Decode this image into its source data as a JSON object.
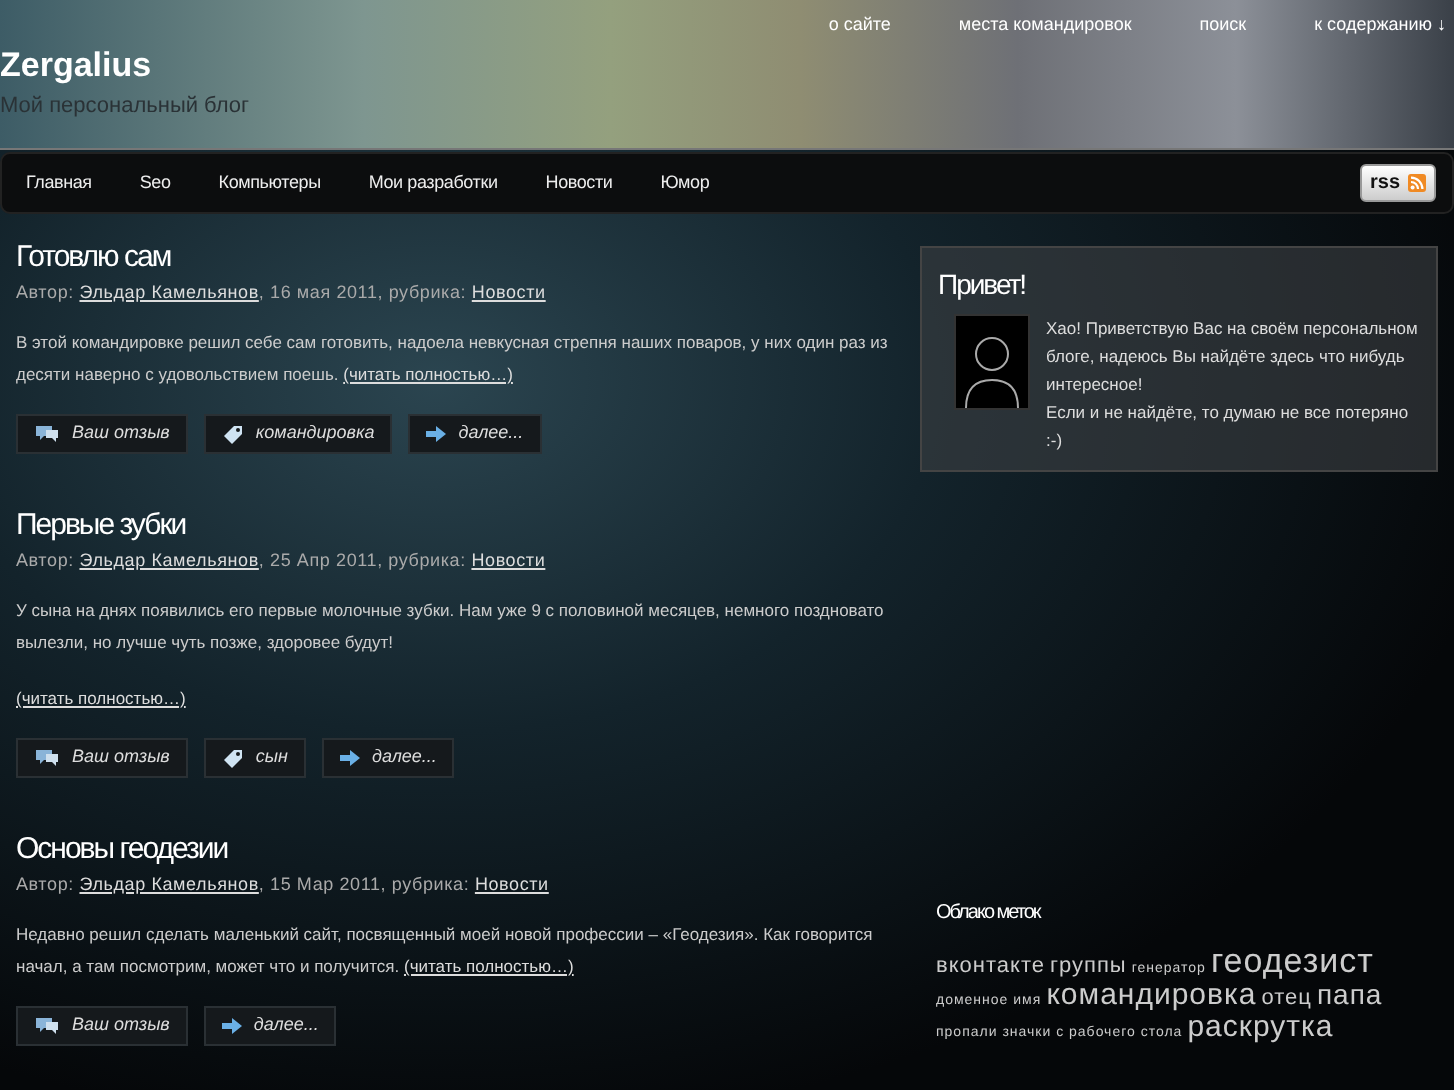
{
  "site": {
    "title": "Zergalius",
    "tagline": "Мой персональный блог"
  },
  "top_links": [
    "о сайте",
    "места командировок",
    "поиск",
    "к содержанию ↓"
  ],
  "nav": [
    "Главная",
    "Seo",
    "Компьютеры",
    "Мои разработки",
    "Новости",
    "Юмор"
  ],
  "rss": {
    "label": "rss"
  },
  "posts": [
    {
      "title": "Готовлю сам",
      "meta": {
        "prefix": "Автор:",
        "author": "Эльдар Камельянов",
        "date": ", 16 мая 2011, рубрика:",
        "category": "Новости"
      },
      "text": "В этой командировке решил себе сам готовить, надоела невкусная стрепня наших поваров, у них один раз из десяти наверно с удовольствием поешь.",
      "read_more": "(читать полностью…)",
      "read_more_separate": false,
      "buttons": [
        {
          "kind": "comment",
          "label": "Ваш отзыв"
        },
        {
          "kind": "tag",
          "label": "командировка"
        },
        {
          "kind": "more",
          "label": "далее..."
        }
      ]
    },
    {
      "title": "Первые зубки",
      "meta": {
        "prefix": "Автор:",
        "author": "Эльдар Камельянов",
        "date": ", 25 Апр 2011, рубрика:",
        "category": "Новости"
      },
      "text": "У сына на днях появились его первые молочные зубки. Нам уже 9 с половиной месяцев, немного поздновато вылезли, но лучше чуть позже, здоровее будут!",
      "read_more": "(читать полностью…)",
      "read_more_separate": true,
      "buttons": [
        {
          "kind": "comment",
          "label": "Ваш отзыв"
        },
        {
          "kind": "tag",
          "label": "сын"
        },
        {
          "kind": "more",
          "label": "далее..."
        }
      ]
    },
    {
      "title": "Основы геодезии",
      "meta": {
        "prefix": "Автор:",
        "author": "Эльдар Камельянов",
        "date": ", 15 Мар 2011, рубрика:",
        "category": "Новости"
      },
      "text": "Недавно решил сделать маленький сайт, посвященный моей новой профессии – «Геодезия». Как говорится начал, а там посмотрим, может что и получится.",
      "read_more": "(читать полностью…)",
      "read_more_separate": false,
      "buttons": [
        {
          "kind": "comment",
          "label": "Ваш отзыв"
        },
        {
          "kind": "more",
          "label": "далее..."
        }
      ]
    }
  ],
  "greeting": {
    "title": "Привет!",
    "text": "Хао! Приветствую Вас на своём персональном блоге, надеюсь Вы найдёте здесь что нибудь интересное!\nЕсли и не найдёте, то думаю не все потеряно :-)"
  },
  "tag_cloud": {
    "title": "Облако меток",
    "tags": [
      {
        "label": "вконтакте",
        "kind": "medium"
      },
      {
        "label": "группы",
        "kind": "medium"
      },
      {
        "label": "генератор",
        "kind": "small"
      },
      {
        "label": "геодезист",
        "kind": "huge"
      },
      {
        "label": "доменное имя",
        "kind": "small"
      },
      {
        "label": "командировка",
        "kind": "large"
      },
      {
        "label": "отец",
        "kind": "medium"
      },
      {
        "label": "папа",
        "kind": "big"
      },
      {
        "label": "пропали значки с рабочего стола",
        "kind": "small"
      },
      {
        "label": "раскрутка",
        "kind": "large"
      }
    ]
  }
}
